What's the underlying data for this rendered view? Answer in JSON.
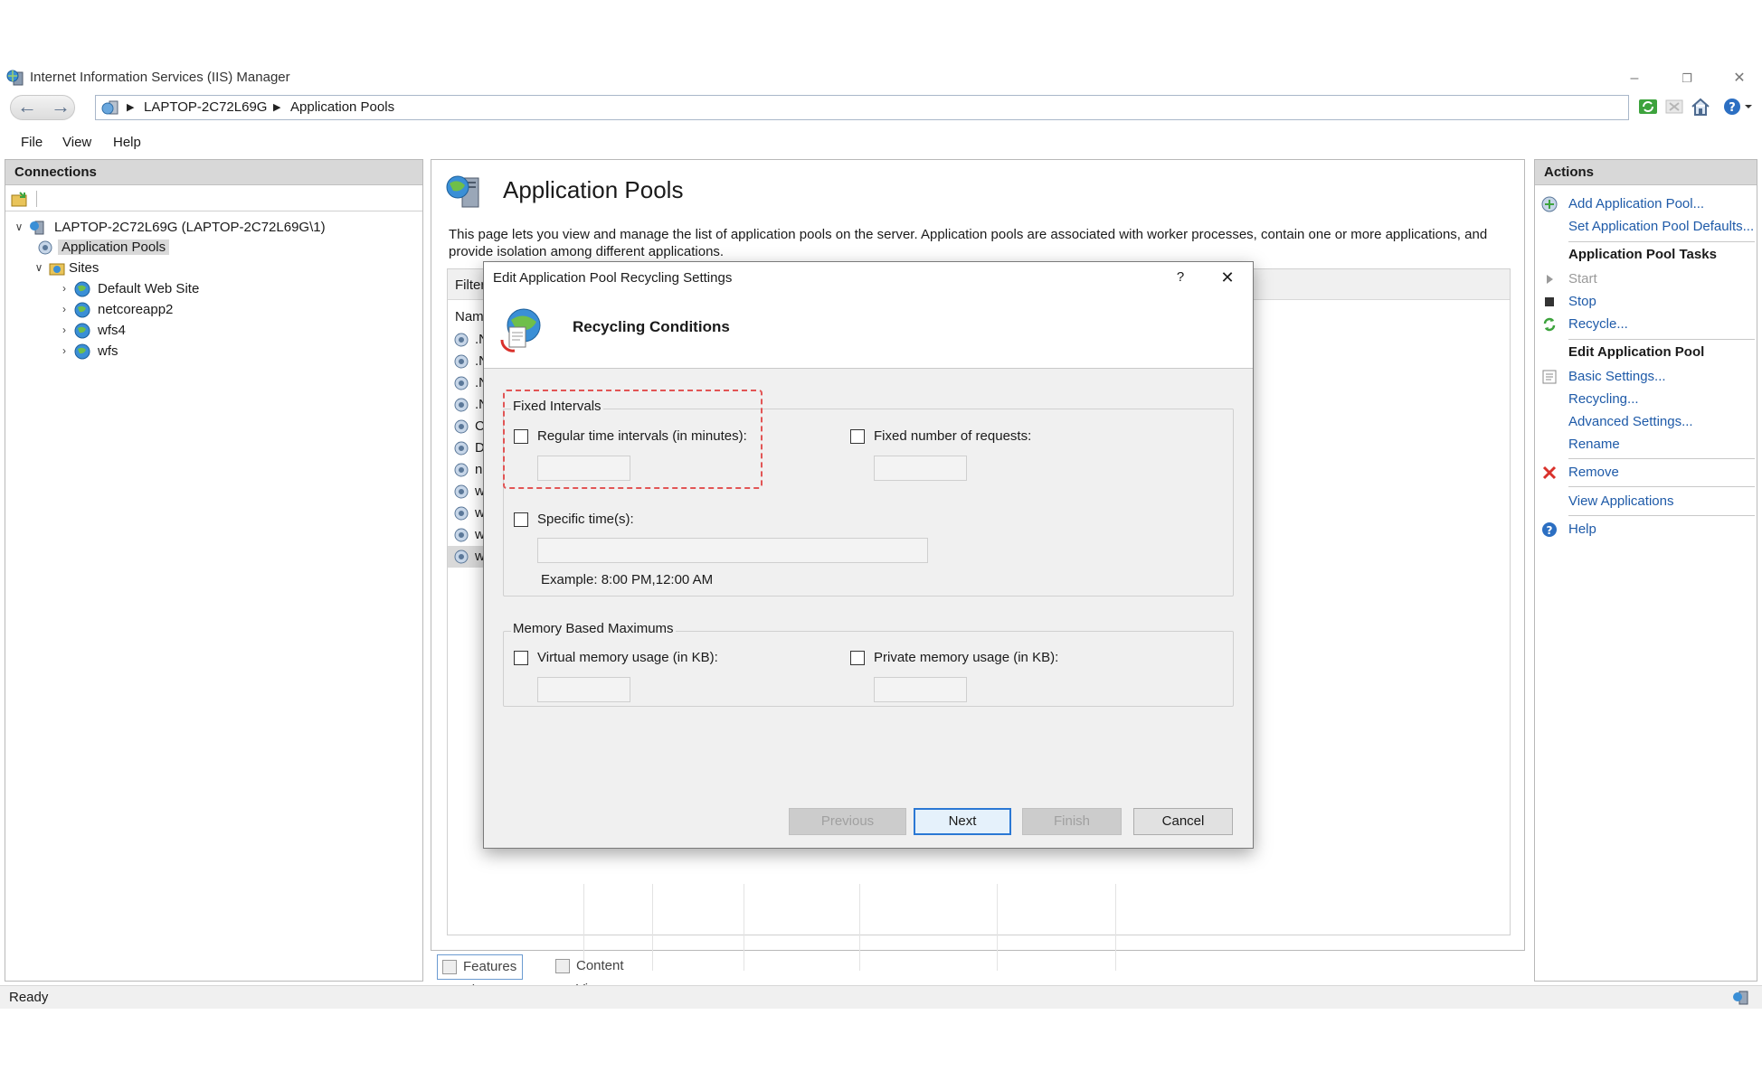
{
  "window": {
    "title": "Internet Information Services (IIS) Manager",
    "minimize": "–",
    "restore": "❐",
    "close": "✕"
  },
  "address": {
    "back": "←",
    "forward": "→",
    "breadcrumbs": [
      "LAPTOP-2C72L69G",
      "Application Pools"
    ],
    "separator": "▶"
  },
  "menu": {
    "items": [
      "File",
      "View",
      "Help"
    ]
  },
  "connections": {
    "header": "Connections",
    "tree": [
      {
        "label": "LAPTOP-2C72L69G (LAPTOP-2C72L69G\\1)",
        "chev": "∨"
      },
      {
        "label": "Application Pools"
      },
      {
        "label": "Sites",
        "chev": "∨"
      },
      {
        "label": "Default Web Site",
        "chev": "›"
      },
      {
        "label": "netcoreapp2",
        "chev": "›"
      },
      {
        "label": "wfs4",
        "chev": "›"
      },
      {
        "label": "wfs",
        "chev": "›"
      }
    ]
  },
  "center": {
    "title": "Application Pools",
    "description": "This page lets you view and manage the list of application pools on the server. Application pools are associated with worker processes, contain one or more applications, and provide isolation among different applications.",
    "filter_label": "Filter",
    "name_header": "Nam",
    "pools": [
      ".N",
      ".N",
      ".N",
      ".N",
      "Cl",
      "De",
      "ne",
      "wf",
      "wf",
      "wf",
      "ws"
    ],
    "views": {
      "features": "Features View",
      "content": "Content View"
    }
  },
  "actions": {
    "header": "Actions",
    "add_pool": "Add Application Pool...",
    "set_defaults": "Set Application Pool Defaults...",
    "tasks_heading": "Application Pool Tasks",
    "start": "Start",
    "stop": "Stop",
    "recycle": "Recycle...",
    "edit_heading": "Edit Application Pool",
    "basic_settings": "Basic Settings...",
    "recycling": "Recycling...",
    "advanced_settings": "Advanced Settings...",
    "rename": "Rename",
    "remove": "Remove",
    "view_applications": "View Applications",
    "help": "Help"
  },
  "status": {
    "text": "Ready"
  },
  "dialog": {
    "title": "Edit Application Pool Recycling Settings",
    "help_glyph": "?",
    "close_glyph": "✕",
    "banner_title": "Recycling Conditions",
    "fixed_intervals": {
      "label": "Fixed Intervals",
      "regular_label": "Regular time intervals (in minutes):",
      "regular_value": "",
      "requests_label": "Fixed number of requests:",
      "requests_value": "",
      "specific_label": "Specific time(s):",
      "specific_value": "",
      "example": "Example: 8:00 PM,12:00 AM"
    },
    "memory": {
      "label": "Memory Based Maximums",
      "virtual_label": "Virtual memory usage (in KB):",
      "virtual_value": "",
      "private_label": "Private memory usage (in KB):",
      "private_value": ""
    },
    "buttons": {
      "previous": "Previous",
      "next": "Next",
      "finish": "Finish",
      "cancel": "Cancel"
    }
  },
  "colors": {
    "link": "#1e5aa8",
    "highlight_border": "#e25555",
    "default_button_border": "#2b78d4",
    "remove_red": "#d9312b",
    "recycle_green": "#3da33d"
  }
}
